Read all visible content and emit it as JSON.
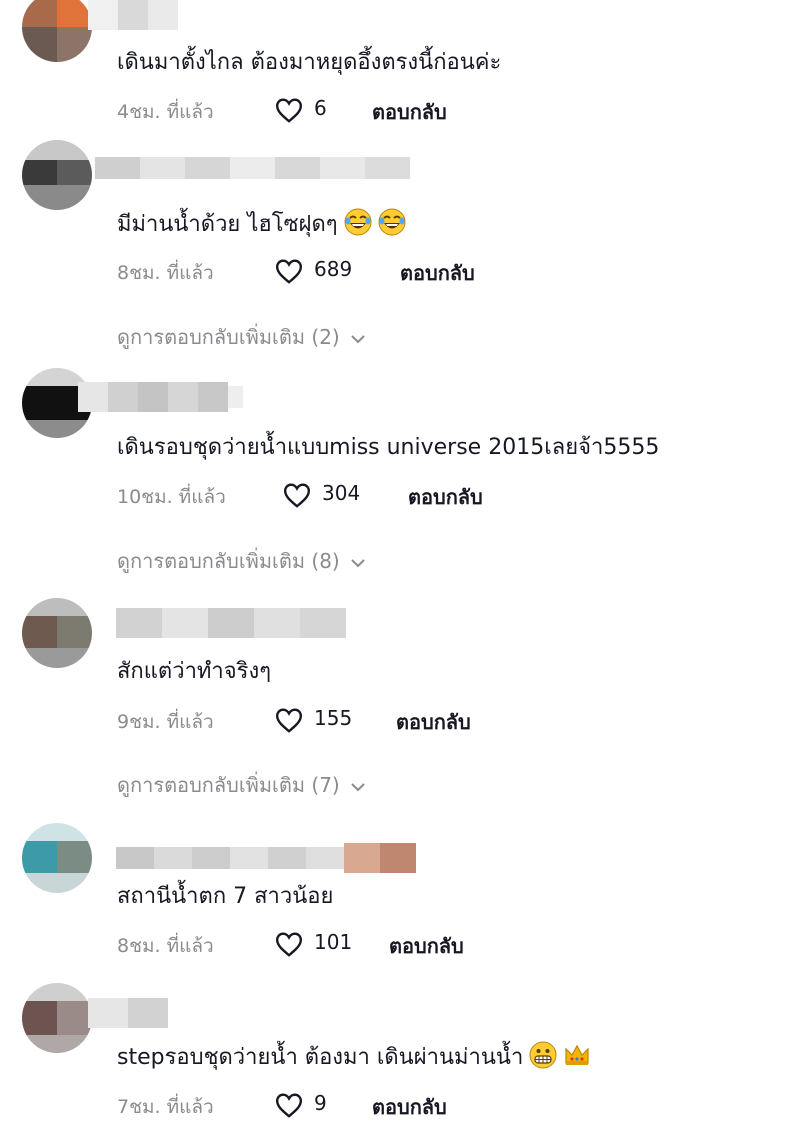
{
  "comments": [
    {
      "text": "เดินมาตั้งไกล ต้องมาหยุดอึ้งตรงนี้ก่อนค่ะ",
      "time": "4ชม. ที่แล้ว",
      "likes": "6",
      "reply": "ตอบกลับ",
      "emojis": []
    },
    {
      "text": "มีม่านน้ำด้วย ไฮโซฝุดๆ",
      "time": "8ชม. ที่แล้ว",
      "likes": "689",
      "reply": "ตอบกลับ",
      "emojis": [
        "laughing-tears-emoji",
        "laughing-tears-emoji"
      ],
      "more_replies": "ดูการตอบกลับเพิ่มเติม (2)"
    },
    {
      "text": "เดินรอบชุดว่ายน้ำแบบmiss universe 2015เลยจ้า5555",
      "time": "10ชม. ที่แล้ว",
      "likes": "304",
      "reply": "ตอบกลับ",
      "emojis": [],
      "more_replies": "ดูการตอบกลับเพิ่มเติม (8)"
    },
    {
      "text": "สักแต่ว่าทำจริงๆ",
      "time": "9ชม. ที่แล้ว",
      "likes": "155",
      "reply": "ตอบกลับ",
      "emojis": [],
      "more_replies": "ดูการตอบกลับเพิ่มเติม (7)"
    },
    {
      "text": "สถานีน้ำตก 7 สาวน้อย",
      "time": "8ชม. ที่แล้ว",
      "likes": "101",
      "reply": "ตอบกลับ",
      "emojis": []
    },
    {
      "text": "stepรอบชุดว่ายน้ำ ต้องมา เดินผ่านม่านน้ำ",
      "time": "7ชม. ที่แล้ว",
      "likes": "9",
      "reply": "ตอบกลับ",
      "emojis": [
        "grimacing-emoji",
        "crown-emoji"
      ]
    }
  ],
  "colors": {
    "text": "#161823",
    "muted": "#8a8b91",
    "background": "#ffffff"
  },
  "icons": [
    "heart-icon",
    "chevron-down-icon"
  ]
}
